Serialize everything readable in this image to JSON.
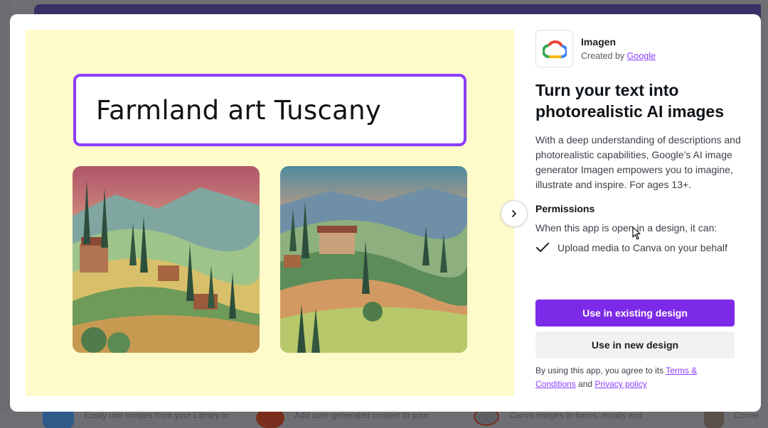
{
  "background": {
    "cards": [
      {
        "text": "Easily use images from your Library in",
        "icon": "library-app-icon"
      },
      {
        "text": "Add user-generated content to your",
        "icon": "ugc-app-icon"
      },
      {
        "text": "Canva images in forms, emails and",
        "icon": "am-app-icon"
      },
      {
        "text": "Conve",
        "icon": "convert-app-icon"
      }
    ]
  },
  "preview": {
    "prompt": "Farmland art Tuscany",
    "next_icon": "chevron-right-icon"
  },
  "app": {
    "name": "Imagen",
    "created_by_label": "Created by",
    "creator": "Google",
    "logo_icon": "google-cloud-icon",
    "heading": "Turn your text into photorealistic AI images",
    "description": "With a deep understanding of descriptions and photorealistic capabilities, Google’s AI image generator Imagen empowers you to imagine, illustrate and inspire. For ages 13+.",
    "permissions": {
      "title": "Permissions",
      "subtitle": "When this app is open in a design, it can:",
      "items": [
        {
          "label": "Upload media to Canva on your behalf",
          "icon": "check-icon"
        }
      ]
    },
    "primary_button": "Use in existing design",
    "secondary_button": "Use in new design",
    "terms": {
      "prefix": "By using this app, you agree to its ",
      "terms_link": "Terms & Conditions",
      "middle": " and ",
      "privacy_link": "Privacy policy"
    }
  },
  "colors": {
    "accent": "#7d2ae8",
    "prompt_border": "#8b3dff",
    "preview_bg": "#fdfbc9"
  }
}
